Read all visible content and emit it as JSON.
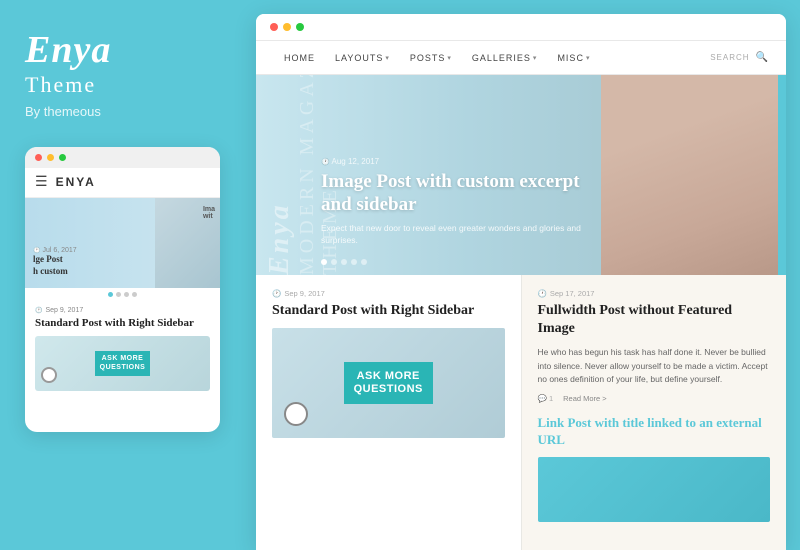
{
  "brand": {
    "title": "Enya",
    "subtitle": "Theme",
    "by": "By themeous"
  },
  "mobile": {
    "nav_title": "ENYA",
    "hero_date": "Jul 6, 2017",
    "hero_left_text": "lge Post\nh custom",
    "hero_right_label": "Ima\nwit",
    "dots": [
      true,
      false,
      false,
      false
    ],
    "post_date_icon": "🕐",
    "post_date": "Sep 9, 2017",
    "post_title": "Standard Post with Right Sidebar",
    "ask_text": "ASK MORE\nQUESTIONS"
  },
  "desktop": {
    "nav": {
      "home": "HOME",
      "layouts": "LAYOUTS",
      "posts": "POSTS",
      "galleries": "GALLERIES",
      "misc": "MISC",
      "search": "SEARCH"
    },
    "hero": {
      "date": "Aug 12, 2017",
      "title": "Image Post with custom excerpt\nand sidebar",
      "excerpt": "Expect that new door to reveal even greater wonders and glories and surprises.",
      "vertical1": "Enya",
      "vertical2": "Modern Magazine\nTheme"
    },
    "post_left": {
      "date": "Sep 9, 2017",
      "title": "Standard Post with Right Sidebar",
      "ask_text": "ASK MORE\nQUESTIONS"
    },
    "post_right": {
      "date": "Sep 17, 2017",
      "title": "Fullwidth Post without Featured Image",
      "text": "He who has begun his task has half done it. Never be bullied into silence. Never allow yourself to be made a victim. Accept no ones definition of your life, but define yourself.",
      "comment_count": "1",
      "read_more": "Read More >",
      "link_title_normal": "Link Post",
      "link_title_colored": " with title linked\nto an external URL"
    }
  }
}
